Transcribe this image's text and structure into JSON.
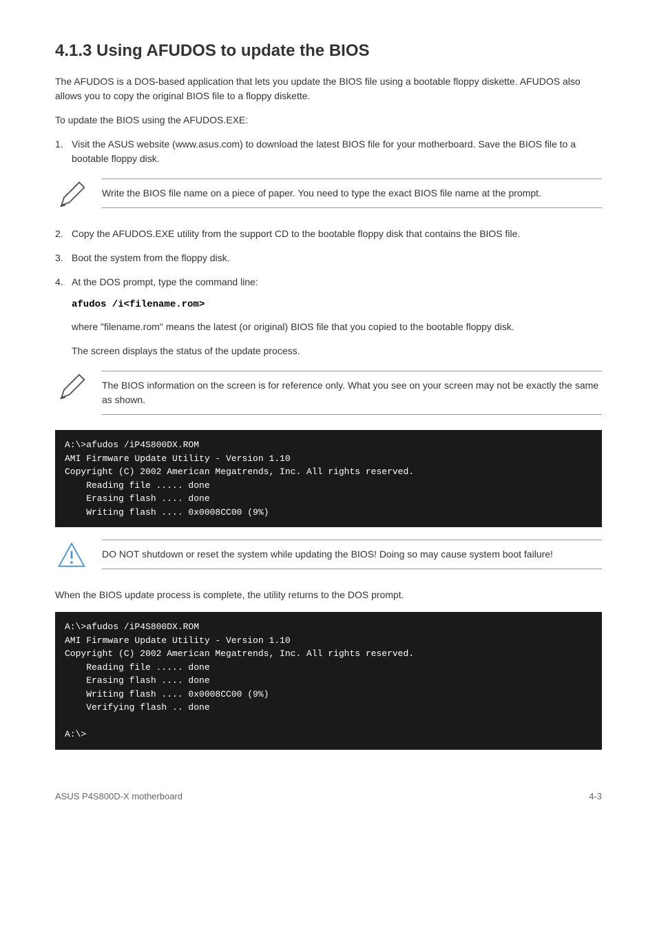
{
  "title": "4.1.3 Using AFUDOS to update the BIOS",
  "intro": "The AFUDOS is a DOS-based application that lets you update the BIOS file using a bootable floppy diskette. AFUDOS also allows you to copy the original BIOS file to a floppy diskette.",
  "steps": {
    "step1": {
      "num": "1.",
      "text_a": "Visit the ASUS website (www.asus.com) to download the latest BIOS file for your motherboard. Save the BIOS file to a bootable floppy disk."
    },
    "note1": "Write the BIOS file name on a piece of paper. You need to type the exact BIOS file name at the prompt.",
    "step2": {
      "num": "2.",
      "text": "Copy the AFUDOS.EXE utility from the support CD to the bootable floppy disk that contains the BIOS file."
    },
    "step3": {
      "num": "3.",
      "text": "Boot the system from the floppy disk."
    },
    "step4": {
      "num": "4.",
      "text": "At the DOS prompt, type the command line:"
    },
    "command": "afudos /i<filename.rom>",
    "command_desc_a": "where \"filename.rom\" means the latest (or original) BIOS file that you copied to the bootable floppy disk.",
    "command_desc_b": "The screen displays the status of the update process.",
    "note2": "The BIOS information on the screen is for reference only. What you see on your screen may not be exactly the same as shown.",
    "terminal1": {
      "line1": "A:\\>afudos /iP4S800DX.ROM",
      "line2": "AMI Firmware Update Utility - Version 1.10",
      "line3": "Copyright (C) 2002 American Megatrends, Inc. All rights reserved.",
      "line4": "    Reading file ..... done",
      "line5": "    Erasing flash .... done",
      "line6": "    Writing flash .... 0x0008CC00 (9%)"
    },
    "warning": "DO NOT shutdown or reset the system while updating the BIOS! Doing so may cause system boot failure!",
    "after_warning": "When the BIOS update process is complete, the utility returns to the DOS prompt.",
    "terminal2": {
      "line1": "A:\\>afudos /iP4S800DX.ROM",
      "line2": "AMI Firmware Update Utility - Version 1.10",
      "line3": "Copyright (C) 2002 American Megatrends, Inc. All rights reserved.",
      "line4": "    Reading file ..... done",
      "line5": "    Erasing flash .... done",
      "line6": "    Writing flash .... 0x0008CC00 (9%)",
      "line7": "    Verifying flash .. done",
      "line8": "A:\\>"
    }
  },
  "footer": {
    "left": "ASUS P4S800D-X motherboard",
    "right": "4-3"
  }
}
